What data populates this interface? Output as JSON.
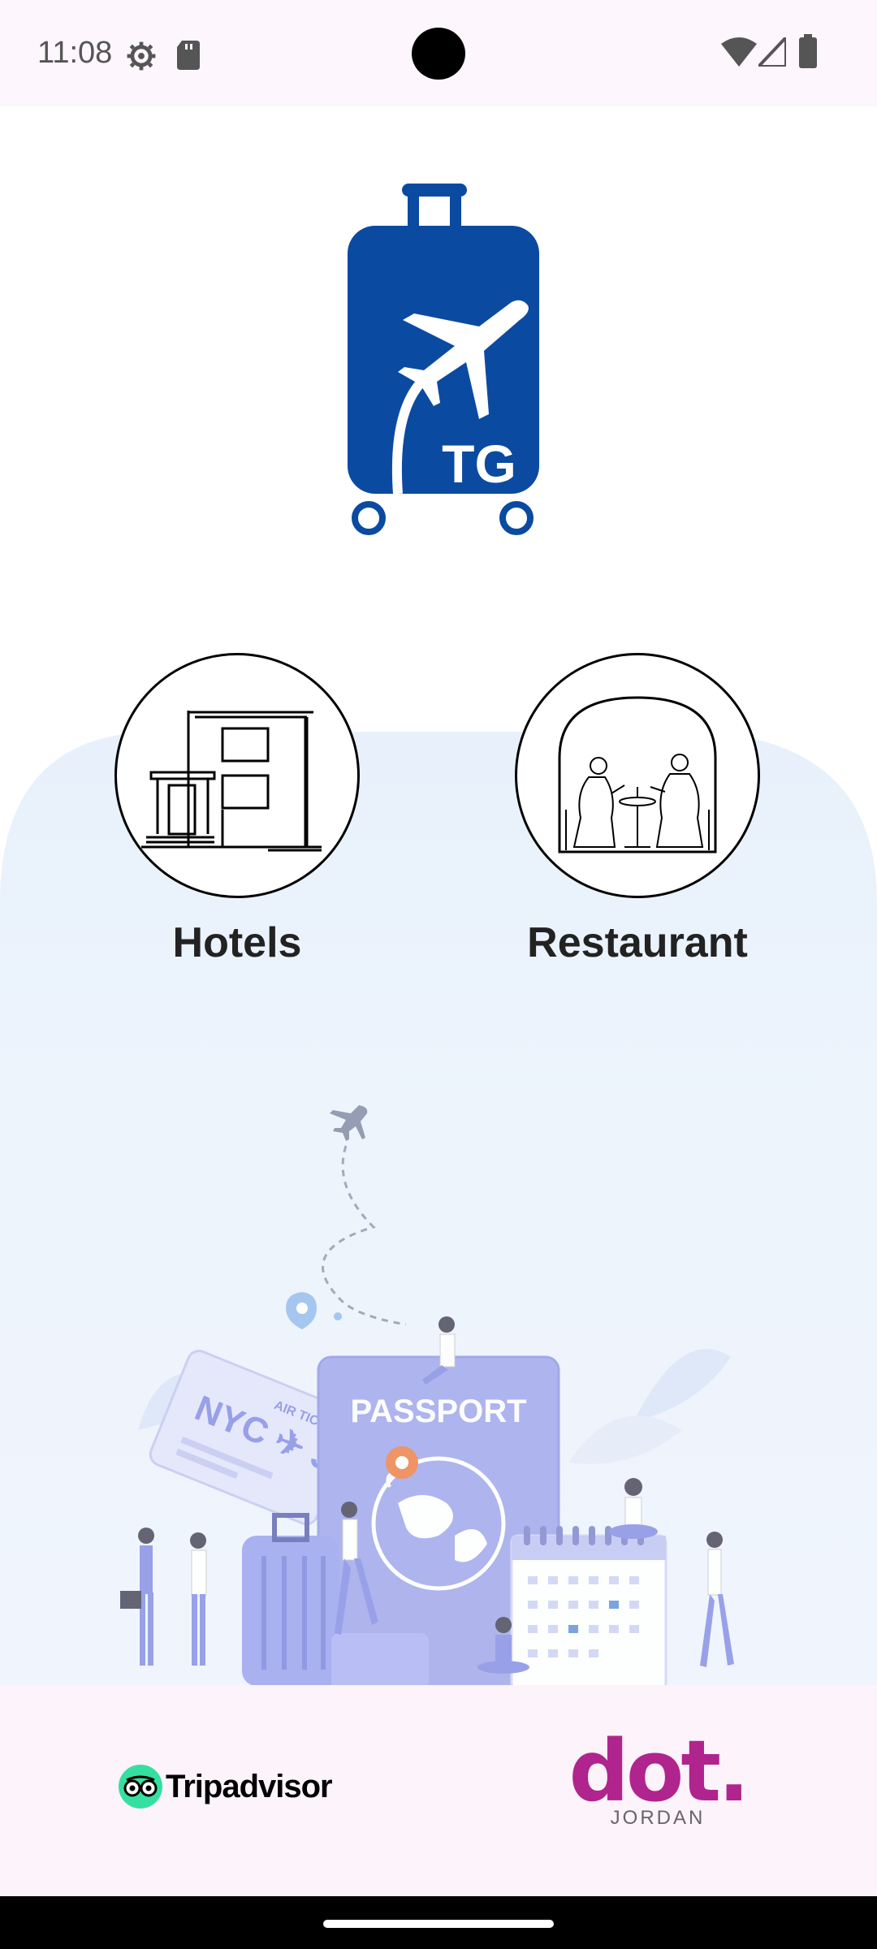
{
  "status_bar": {
    "time": "11:08"
  },
  "logo": {
    "text": "TG",
    "color": "#0b4aa1"
  },
  "categories": [
    {
      "label": "Hotels"
    },
    {
      "label": "Restaurant"
    }
  ],
  "illustration": {
    "passport_text": "PASSPORT",
    "ticket_text": "NYC ✈ JP",
    "ticket_sub": "AIR TICKET"
  },
  "footer": {
    "tripadvisor": "Tripadvisor",
    "dot_logo": "dot.",
    "dot_sub": "JORDAN"
  },
  "colors": {
    "brand_blue": "#0b4aa1",
    "tripadvisor_green": "#34e0a1",
    "dot_purple": "#b0248e",
    "illustration": "#8f98e6"
  }
}
